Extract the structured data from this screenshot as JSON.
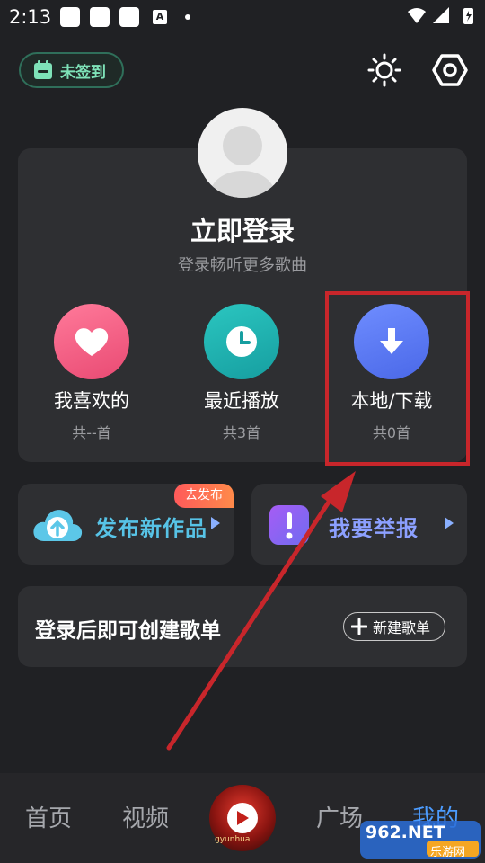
{
  "status_bar": {
    "time": "2:13",
    "a_icon": "A"
  },
  "header": {
    "signin_label": "未签到"
  },
  "profile": {
    "login_title": "立即登录",
    "login_subtitle": "登录畅听更多歌曲"
  },
  "quick_access": [
    {
      "label": "我喜欢的",
      "count": "共--首",
      "icon": "heart-icon",
      "color": "#f05a7e"
    },
    {
      "label": "最近播放",
      "count": "共3首",
      "icon": "clock-icon",
      "color": "#1fb5b2"
    },
    {
      "label": "本地/下载",
      "count": "共0首",
      "icon": "download-icon",
      "color": "#5b7cf5"
    }
  ],
  "actions": {
    "publish_label": "发布新作品",
    "publish_badge": "去发布",
    "report_label": "我要举报"
  },
  "playlist": {
    "prompt": "登录后即可创建歌单",
    "new_button": "新建歌单"
  },
  "bottom_nav": {
    "items": [
      "首页",
      "视频",
      "广场",
      "我的"
    ],
    "active": "我的",
    "disc_caption": "gyunhua"
  },
  "watermark": {
    "brand": "962.NET",
    "sub": "乐游网"
  },
  "colors": {
    "accent_blue": "#4c9cff",
    "highlight_red": "#c8262b",
    "signin_green": "#7ee2b8"
  }
}
